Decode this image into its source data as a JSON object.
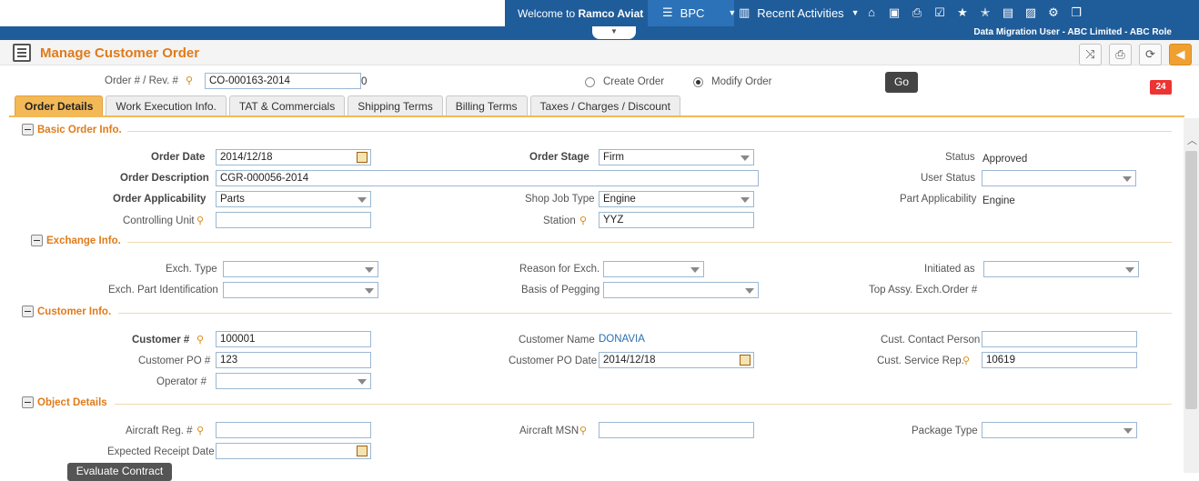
{
  "topbar": {
    "welcome_prefix": "Welcome to",
    "welcome_brand": "Ramco Aviat",
    "bpc_label": "BPC",
    "recent_label": "Recent Activities",
    "user_line": "Data Migration User - ABC Limited - ABC Role",
    "icons": [
      "home-icon",
      "ms-icon",
      "inbox-icon",
      "check-icon",
      "star-icon",
      "star-plus-icon",
      "dw-icon",
      "picture-icon",
      "gear-icon",
      "window-icon"
    ]
  },
  "page": {
    "title": "Manage Customer Order"
  },
  "search": {
    "order_label": "Order # / Rev. #",
    "order_value": "CO-000163-2014",
    "rev_value": "0",
    "create_label": "Create Order",
    "modify_label": "Modify Order",
    "go_label": "Go"
  },
  "notifications": {
    "count": "24"
  },
  "tabs": [
    {
      "label": "Order Details"
    },
    {
      "label": "Work Execution Info."
    },
    {
      "label": "TAT & Commercials"
    },
    {
      "label": "Shipping Terms"
    },
    {
      "label": "Billing Terms"
    },
    {
      "label": "Taxes / Charges / Discount"
    }
  ],
  "basic": {
    "heading": "Basic Order Info.",
    "order_date_label": "Order Date",
    "order_date_value": "2014/12/18",
    "order_stage_label": "Order Stage",
    "order_stage_value": "Firm",
    "status_label": "Status",
    "status_value": "Approved",
    "order_desc_label": "Order Description",
    "order_desc_value": "CGR-000056-2014",
    "user_status_label": "User Status",
    "user_status_value": "",
    "order_app_label": "Order Applicability",
    "order_app_value": "Parts",
    "shop_job_label": "Shop Job Type",
    "shop_job_value": "Engine",
    "part_app_label": "Part Applicability",
    "part_app_value": "Engine",
    "ctrl_unit_label": "Controlling Unit",
    "ctrl_unit_value": "",
    "station_label": "Station",
    "station_value": "YYZ"
  },
  "exchange": {
    "heading": "Exchange Info.",
    "exch_type_label": "Exch. Type",
    "reason_label": "Reason for Exch.",
    "initiated_label": "Initiated as",
    "part_id_label": "Exch. Part Identification",
    "pegging_label": "Basis of Pegging",
    "top_assy_label": "Top Assy. Exch.Order #"
  },
  "customer": {
    "heading": "Customer Info.",
    "cust_no_label": "Customer #",
    "cust_no_value": "100001",
    "cust_name_label": "Customer Name",
    "cust_name_value": "DONAVIA",
    "contact_label": "Cust. Contact Person",
    "contact_value": "",
    "po_label": "Customer PO #",
    "po_value": "123",
    "po_date_label": "Customer PO Date",
    "po_date_value": "2014/12/18",
    "service_rep_label": "Cust. Service Rep.",
    "service_rep_value": "10619",
    "operator_label": "Operator #"
  },
  "object": {
    "heading": "Object Details",
    "aircraft_reg_label": "Aircraft Reg. #",
    "aircraft_msn_label": "Aircraft MSN",
    "package_type_label": "Package Type",
    "expected_label": "Expected Receipt Date",
    "evaluate_label": "Evaluate Contract"
  }
}
